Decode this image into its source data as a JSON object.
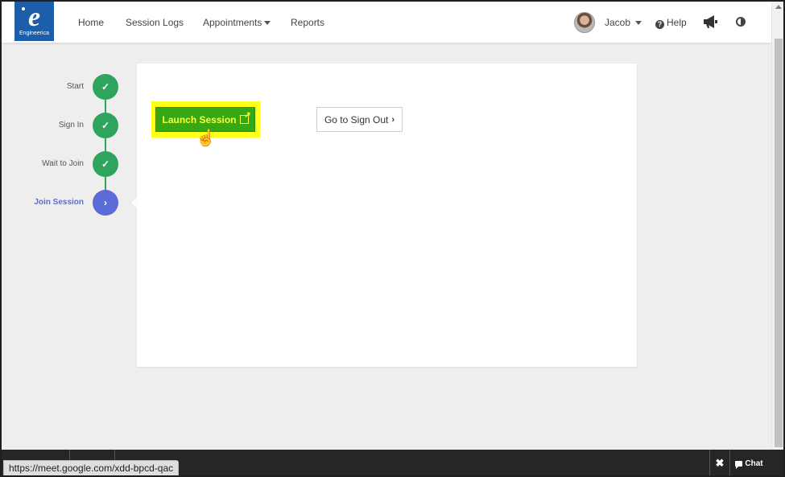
{
  "brand": {
    "logo_letter": "e",
    "logo_text": "Engineerica",
    "color": "#1c5fa8"
  },
  "nav": {
    "home": "Home",
    "session_logs": "Session Logs",
    "appointments": "Appointments",
    "reports": "Reports"
  },
  "user": {
    "name": "Jacob"
  },
  "help": {
    "label": "Help",
    "icon": "?"
  },
  "steps": [
    {
      "label": "Start",
      "status": "done",
      "icon": "✓"
    },
    {
      "label": "Sign In",
      "status": "done",
      "icon": "✓"
    },
    {
      "label": "Wait to Join",
      "status": "done",
      "icon": "✓"
    },
    {
      "label": "Join Session",
      "status": "active",
      "icon": "›"
    }
  ],
  "actions": {
    "launch_label": "Launch Session",
    "signout_label": "Go to Sign Out",
    "signout_chevron": "›"
  },
  "cursor": {
    "glyph": "☝"
  },
  "footer": {
    "status_url": "https://meet.google.com/xdd-bpcd-qac",
    "close_glyph": "✖",
    "chat_label": "Chat"
  },
  "colors": {
    "accent": "#5b6cd8",
    "success": "#2ea55e",
    "launch_button": "#35a813",
    "highlight": "#ffff1a"
  }
}
